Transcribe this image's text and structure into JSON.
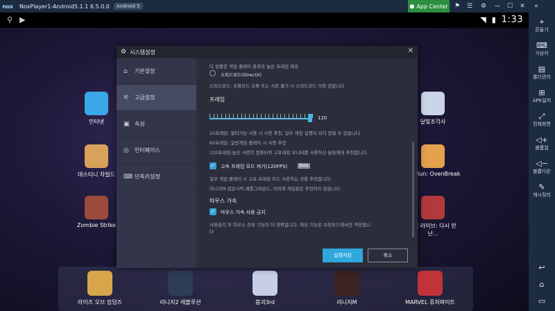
{
  "titlebar": {
    "logo": "nox",
    "title": "NoxPlayer1-Android5.1.1 6.5.0.0",
    "android_badge": "Android 5",
    "app_center": "App Center"
  },
  "statusbar": {
    "time": "1:33"
  },
  "desktop": {
    "apps": [
      {
        "label": "인터넷",
        "color": "#3aa7e8"
      },
      {
        "label": "데스티니 차일드",
        "color": "#d9a25b"
      },
      {
        "label": "Zombie Strike",
        "color": "#9b4b3b"
      },
      {
        "label": "달빛조각사",
        "color": "#c9d4e6"
      },
      {
        "label": "kie Run: OvenBreak",
        "color": "#e3a04d"
      },
      {
        "label": "] 어 라이브: 다시 만난...",
        "color": "#b33a3a"
      }
    ],
    "dock": [
      {
        "label": "라이즈 오브 킹덤즈",
        "color": "#d8a64a"
      },
      {
        "label": "리니지2 레볼루션",
        "color": "#2e3d57"
      },
      {
        "label": "붕괴3rd",
        "color": "#c7cfe6"
      },
      {
        "label": "리니지M",
        "color": "#3a2320"
      },
      {
        "label": "MARVEL 퓨처파이트",
        "color": "#c0333a"
      }
    ]
  },
  "sidebar": {
    "items": [
      {
        "label": "흔들기",
        "icon": "shake-icon"
      },
      {
        "label": "가상키",
        "icon": "keyboard-icon"
      },
      {
        "label": "폴더관리",
        "icon": "folder-icon"
      },
      {
        "label": "APK설치",
        "icon": "apk-icon"
      },
      {
        "label": "전체화면",
        "icon": "fullscreen-icon"
      },
      {
        "label": "볼륨업",
        "icon": "volume-up-icon"
      },
      {
        "label": "볼륨다운",
        "icon": "volume-down-icon"
      },
      {
        "label": "캐시정리",
        "icon": "clean-icon"
      }
    ]
  },
  "dialog": {
    "title": "시스템설정",
    "nav": [
      {
        "label": "기본설정",
        "icon": "home-icon"
      },
      {
        "label": "고급설정",
        "icon": "sliders-icon"
      },
      {
        "label": "속성",
        "icon": "property-icon"
      },
      {
        "label": "인터페이스",
        "icon": "interface-icon"
      },
      {
        "label": "단축키설정",
        "icon": "keyboard-icon"
      }
    ],
    "content": {
      "top_text": "더 원활한 게임 플레이 환경과 높은 프레임 제공",
      "speed_mode_label": "스피드모드(DirectX)",
      "speed_mode_desc": "스피드모드: 호환모드 오류 또는 사용 불가 시 스피드모드 이용 권합니다",
      "frame_title": "프레임",
      "frame_value": "120",
      "frame_fill_pct": 98,
      "frame_desc": [
        "20프레임: 멀티기능 사용 시 사용 추천, 일부 게임 실행이 되지 않을 수 있습니다",
        "60프레임: 일반게임 플레이 시 사용 추천",
        "120프레임:높은 사양의 컴퓨터와 고프레임 모니터를 사용하신 분들에게 추천합니다."
      ],
      "hfr_label": "고속 프레임 모드 켜기(120FPS)",
      "beta": "Beta",
      "hfr_desc": [
        "일부 게임 플레이 시 고속 프레임 모드 사용하는 것을 추천합니다.",
        "리니지M,검은사막,배틀그라운드, 이외에 게임들은 추천하지 않습니다."
      ],
      "mouse_title": "마우스 가속",
      "mouse_label": "마우스 가속 사용 금지",
      "mouse_desc": [
        "사용금지 후 마우스 슈팅 기능이 더 정확합니다. 해당 기능은 슈팅모드에서만 적용됩니",
        "다"
      ]
    },
    "save_label": "설정저장",
    "cancel_label": "취소"
  }
}
